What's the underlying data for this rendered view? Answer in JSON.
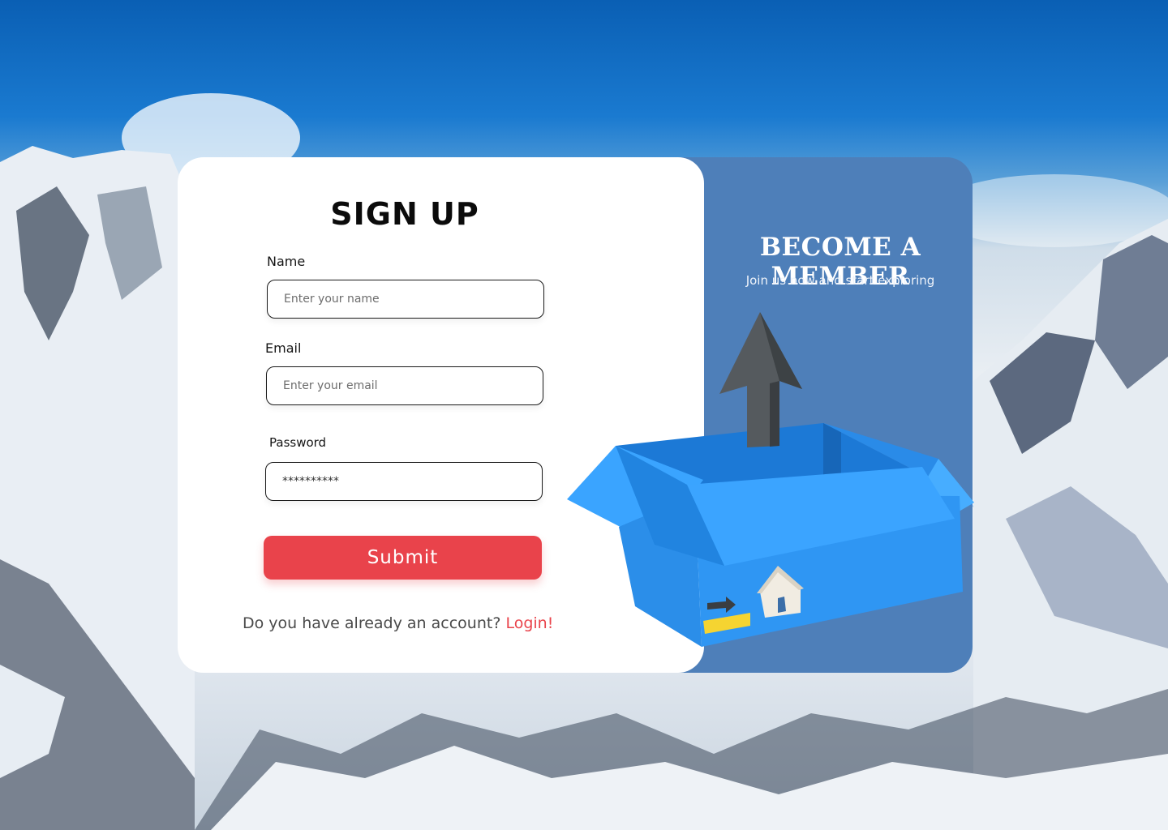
{
  "signup": {
    "title": "SIGN UP",
    "name_label": "Name",
    "name_placeholder": "Enter your name",
    "email_label": "Email",
    "email_placeholder": "Enter your email",
    "password_label": "Password",
    "password_value": "**********",
    "submit_label": "Submit",
    "account_prompt": "Do you have already an account?",
    "login_label": "Login!"
  },
  "cta": {
    "title": "BECOME A MEMBER",
    "subtitle": "Join us now and start exploring"
  },
  "colors": {
    "accent_red": "#e9434b",
    "panel_blue": "#4e7fb9",
    "box_blue": "#2f96f3",
    "sky_blue": "#0a5fb4"
  },
  "icons": {
    "arrow": "arrow-up-icon",
    "box": "open-box-icon",
    "home": "home-icon"
  }
}
